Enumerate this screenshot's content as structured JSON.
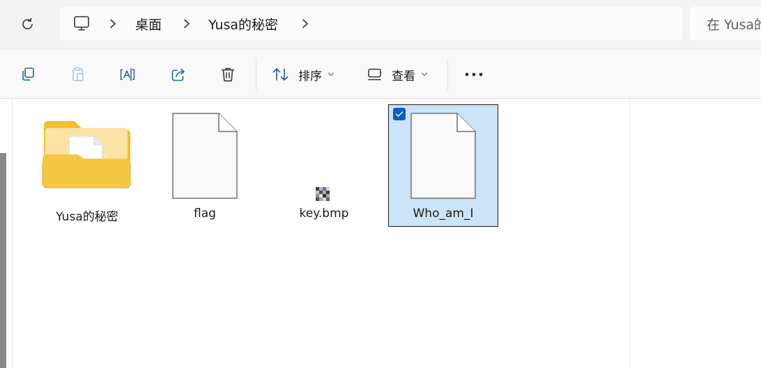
{
  "breadcrumb": {
    "items": [
      "桌面",
      "Yusa的秘密"
    ]
  },
  "search": {
    "placeholder": "在 Yusa的"
  },
  "toolbar": {
    "sort_label": "排序",
    "view_label": "查看"
  },
  "files": [
    {
      "name": "Yusa的秘密",
      "type": "folder"
    },
    {
      "name": "flag",
      "type": "file"
    },
    {
      "name": "key.bmp",
      "type": "image"
    },
    {
      "name": "Who_am_I",
      "type": "file",
      "selected": true
    }
  ],
  "colors": {
    "selection": "#cce4f7",
    "check_accent": "#0a5fc4",
    "folder": "#f4c236",
    "toolbar_icon": "#1f5fa8"
  }
}
